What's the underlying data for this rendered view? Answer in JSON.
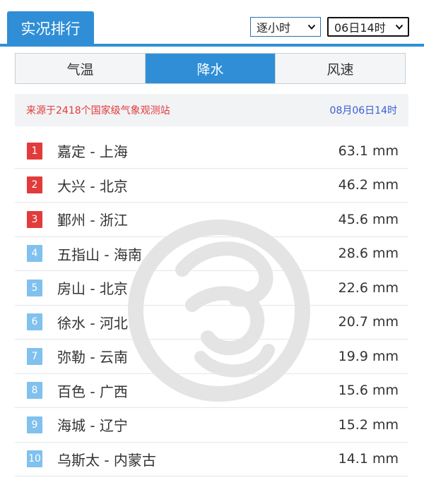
{
  "header": {
    "title": "实况排行",
    "mode_select": "逐小时",
    "time_select": "06日14时"
  },
  "tabs": [
    {
      "label": "气温",
      "active": false
    },
    {
      "label": "降水",
      "active": true
    },
    {
      "label": "风速",
      "active": false
    }
  ],
  "info": {
    "source": "来源于2418个国家级气象观测站",
    "timestamp": "08月06日14时"
  },
  "ranking": [
    {
      "rank": "1",
      "location": "嘉定 - 上海",
      "value": "63.1 mm"
    },
    {
      "rank": "2",
      "location": "大兴 - 北京",
      "value": "46.2 mm"
    },
    {
      "rank": "3",
      "location": "鄞州 - 浙江",
      "value": "45.6 mm"
    },
    {
      "rank": "4",
      "location": "五指山 - 海南",
      "value": "28.6 mm"
    },
    {
      "rank": "5",
      "location": "房山 - 北京",
      "value": "22.6 mm"
    },
    {
      "rank": "6",
      "location": "徐水 - 河北",
      "value": "20.7 mm"
    },
    {
      "rank": "7",
      "location": "弥勒 - 云南",
      "value": "19.9 mm"
    },
    {
      "rank": "8",
      "location": "百色 - 广西",
      "value": "15.6 mm"
    },
    {
      "rank": "9",
      "location": "海城 - 辽宁",
      "value": "15.2 mm"
    },
    {
      "rank": "10",
      "location": "乌斯太 - 内蒙古",
      "value": "14.1 mm"
    }
  ],
  "colors": {
    "accent": "#2f8ed6",
    "top_rank": "#e23b3b",
    "other_rank": "#80c1ee",
    "source_text": "#e23b3b",
    "timestamp_text": "#3b5cd6"
  },
  "icons": {
    "select_arrow": "chevron-down-icon",
    "watermark": "watermark-logo"
  }
}
